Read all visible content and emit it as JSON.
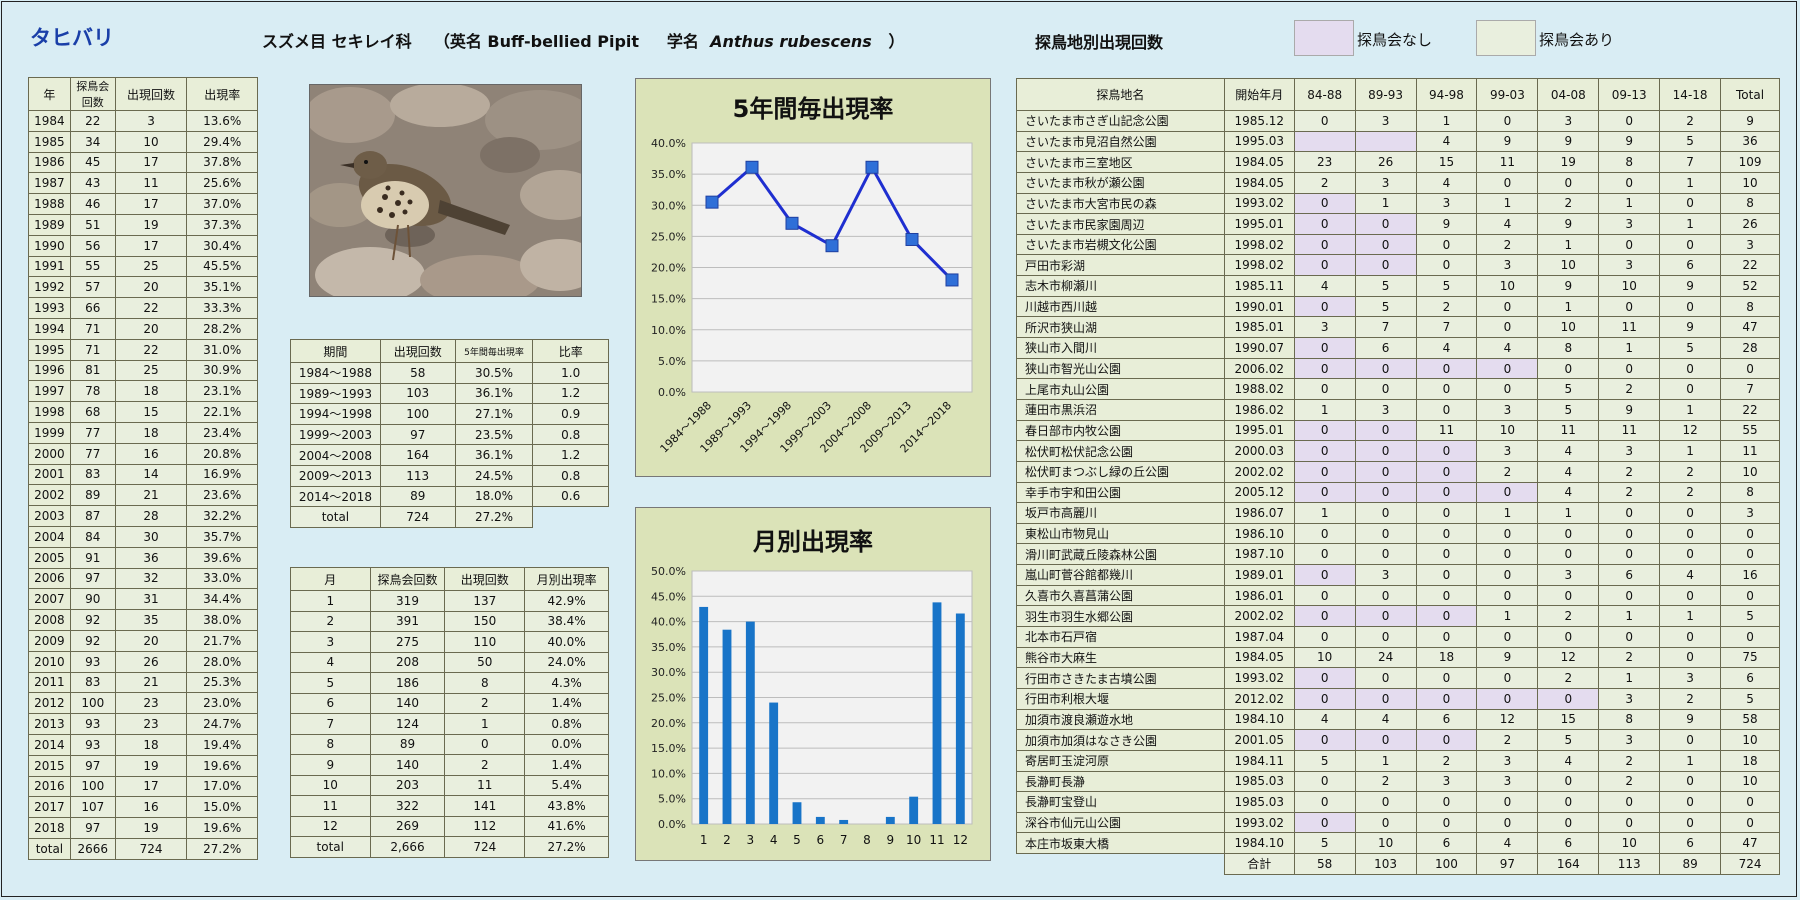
{
  "header": {
    "title": "タヒバリ",
    "order_family": "スズメ目 セキレイ科",
    "english_label": "（英名 Buff-bellied Pipit",
    "sci_label": "学名",
    "sci_name": "Anthus rubescens",
    "close_paren": "）",
    "site_table_heading": "探鳥地別出現回数",
    "legend_no_meeting": "探鳥会なし",
    "legend_meeting": "探鳥会あり",
    "colors": {
      "no_meeting": "#e4dcef",
      "meeting": "#e9efde",
      "title": "#1a3fa8",
      "series": "#1f2fd0",
      "bar": "#1874c8"
    }
  },
  "year_table": {
    "headers": [
      "年",
      "探鳥会回数",
      "出現回数",
      "出現率"
    ],
    "rows": [
      [
        "1984",
        "22",
        "3",
        "13.6%"
      ],
      [
        "1985",
        "34",
        "10",
        "29.4%"
      ],
      [
        "1986",
        "45",
        "17",
        "37.8%"
      ],
      [
        "1987",
        "43",
        "11",
        "25.6%"
      ],
      [
        "1988",
        "46",
        "17",
        "37.0%"
      ],
      [
        "1989",
        "51",
        "19",
        "37.3%"
      ],
      [
        "1990",
        "56",
        "17",
        "30.4%"
      ],
      [
        "1991",
        "55",
        "25",
        "45.5%"
      ],
      [
        "1992",
        "57",
        "20",
        "35.1%"
      ],
      [
        "1993",
        "66",
        "22",
        "33.3%"
      ],
      [
        "1994",
        "71",
        "20",
        "28.2%"
      ],
      [
        "1995",
        "71",
        "22",
        "31.0%"
      ],
      [
        "1996",
        "81",
        "25",
        "30.9%"
      ],
      [
        "1997",
        "78",
        "18",
        "23.1%"
      ],
      [
        "1998",
        "68",
        "15",
        "22.1%"
      ],
      [
        "1999",
        "77",
        "18",
        "23.4%"
      ],
      [
        "2000",
        "77",
        "16",
        "20.8%"
      ],
      [
        "2001",
        "83",
        "14",
        "16.9%"
      ],
      [
        "2002",
        "89",
        "21",
        "23.6%"
      ],
      [
        "2003",
        "87",
        "28",
        "32.2%"
      ],
      [
        "2004",
        "84",
        "30",
        "35.7%"
      ],
      [
        "2005",
        "91",
        "36",
        "39.6%"
      ],
      [
        "2006",
        "97",
        "32",
        "33.0%"
      ],
      [
        "2007",
        "90",
        "31",
        "34.4%"
      ],
      [
        "2008",
        "92",
        "35",
        "38.0%"
      ],
      [
        "2009",
        "92",
        "20",
        "21.7%"
      ],
      [
        "2010",
        "93",
        "26",
        "28.0%"
      ],
      [
        "2011",
        "83",
        "21",
        "25.3%"
      ],
      [
        "2012",
        "100",
        "23",
        "23.0%"
      ],
      [
        "2013",
        "93",
        "23",
        "24.7%"
      ],
      [
        "2014",
        "93",
        "18",
        "19.4%"
      ],
      [
        "2015",
        "97",
        "19",
        "19.6%"
      ],
      [
        "2016",
        "100",
        "17",
        "17.0%"
      ],
      [
        "2017",
        "107",
        "16",
        "15.0%"
      ],
      [
        "2018",
        "97",
        "19",
        "19.6%"
      ],
      [
        "total",
        "2666",
        "724",
        "27.2%"
      ]
    ]
  },
  "period_table": {
    "headers": [
      "期間",
      "出現回数",
      "5年間毎出現率",
      "比率"
    ],
    "rows": [
      [
        "1984～1988",
        "58",
        "30.5%",
        "1.0"
      ],
      [
        "1989～1993",
        "103",
        "36.1%",
        "1.2"
      ],
      [
        "1994～1998",
        "100",
        "27.1%",
        "0.9"
      ],
      [
        "1999～2003",
        "97",
        "23.5%",
        "0.8"
      ],
      [
        "2004～2008",
        "164",
        "36.1%",
        "1.2"
      ],
      [
        "2009～2013",
        "113",
        "24.5%",
        "0.8"
      ],
      [
        "2014～2018",
        "89",
        "18.0%",
        "0.6"
      ]
    ],
    "total_row": [
      "total",
      "724",
      "27.2%"
    ]
  },
  "month_table": {
    "headers": [
      "月",
      "探鳥会回数",
      "出現回数",
      "月別出現率"
    ],
    "rows": [
      [
        "1",
        "319",
        "137",
        "42.9%"
      ],
      [
        "2",
        "391",
        "150",
        "38.4%"
      ],
      [
        "3",
        "275",
        "110",
        "40.0%"
      ],
      [
        "4",
        "208",
        "50",
        "24.0%"
      ],
      [
        "5",
        "186",
        "8",
        "4.3%"
      ],
      [
        "6",
        "140",
        "2",
        "1.4%"
      ],
      [
        "7",
        "124",
        "1",
        "0.8%"
      ],
      [
        "8",
        "89",
        "0",
        "0.0%"
      ],
      [
        "9",
        "140",
        "2",
        "1.4%"
      ],
      [
        "10",
        "203",
        "11",
        "5.4%"
      ],
      [
        "11",
        "322",
        "141",
        "43.8%"
      ],
      [
        "12",
        "269",
        "112",
        "41.6%"
      ],
      [
        "total",
        "2,666",
        "724",
        "27.2%"
      ]
    ]
  },
  "site_table": {
    "headers": [
      "探鳥地名",
      "開始年月",
      "84-88",
      "89-93",
      "94-98",
      "99-03",
      "04-08",
      "09-13",
      "14-18",
      "Total"
    ],
    "rows": [
      [
        "さいたま市さぎ山記念公園",
        "1985.12",
        "0",
        "3",
        "1",
        "0",
        "3",
        "0",
        "2",
        "9"
      ],
      [
        "さいたま市見沼自然公園",
        "1995.03",
        "",
        "",
        "4",
        "9",
        "9",
        "9",
        "5",
        "36"
      ],
      [
        "さいたま市三室地区",
        "1984.05",
        "23",
        "26",
        "15",
        "11",
        "19",
        "8",
        "7",
        "109"
      ],
      [
        "さいたま市秋が瀬公園",
        "1984.05",
        "2",
        "3",
        "4",
        "0",
        "0",
        "0",
        "1",
        "10"
      ],
      [
        "さいたま市大宮市民の森",
        "1993.02",
        "0",
        "1",
        "3",
        "1",
        "2",
        "1",
        "0",
        "8"
      ],
      [
        "さいたま市民家園周辺",
        "1995.01",
        "0",
        "0",
        "9",
        "4",
        "9",
        "3",
        "1",
        "26"
      ],
      [
        "さいたま市岩槻文化公園",
        "1998.02",
        "0",
        "0",
        "0",
        "2",
        "1",
        "0",
        "0",
        "3"
      ],
      [
        "戸田市彩湖",
        "1998.02",
        "0",
        "0",
        "0",
        "3",
        "10",
        "3",
        "6",
        "22"
      ],
      [
        "志木市柳瀬川",
        "1985.11",
        "4",
        "5",
        "5",
        "10",
        "9",
        "10",
        "9",
        "52"
      ],
      [
        "川越市西川越",
        "1990.01",
        "0",
        "5",
        "2",
        "0",
        "1",
        "0",
        "0",
        "8"
      ],
      [
        "所沢市狭山湖",
        "1985.01",
        "3",
        "7",
        "7",
        "0",
        "10",
        "11",
        "9",
        "47"
      ],
      [
        "狭山市入間川",
        "1990.07",
        "0",
        "6",
        "4",
        "4",
        "8",
        "1",
        "5",
        "28"
      ],
      [
        "狭山市智光山公園",
        "2006.02",
        "0",
        "0",
        "0",
        "0",
        "0",
        "0",
        "0",
        "0"
      ],
      [
        "上尾市丸山公園",
        "1988.02",
        "0",
        "0",
        "0",
        "0",
        "5",
        "2",
        "0",
        "7"
      ],
      [
        "蓮田市黒浜沼",
        "1986.02",
        "1",
        "3",
        "0",
        "3",
        "5",
        "9",
        "1",
        "22"
      ],
      [
        "春日部市内牧公園",
        "1995.01",
        "0",
        "0",
        "11",
        "10",
        "11",
        "11",
        "12",
        "55"
      ],
      [
        "松伏町松伏記念公園",
        "2000.03",
        "0",
        "0",
        "0",
        "3",
        "4",
        "3",
        "1",
        "11"
      ],
      [
        "松伏町まつぶし緑の丘公園",
        "2002.02",
        "0",
        "0",
        "0",
        "2",
        "4",
        "2",
        "2",
        "10"
      ],
      [
        "幸手市宇和田公園",
        "2005.12",
        "0",
        "0",
        "0",
        "0",
        "4",
        "2",
        "2",
        "8"
      ],
      [
        "坂戸市高麗川",
        "1986.07",
        "1",
        "0",
        "0",
        "1",
        "1",
        "0",
        "0",
        "3"
      ],
      [
        "東松山市物見山",
        "1986.10",
        "0",
        "0",
        "0",
        "0",
        "0",
        "0",
        "0",
        "0"
      ],
      [
        "滑川町武蔵丘陵森林公園",
        "1987.10",
        "0",
        "0",
        "0",
        "0",
        "0",
        "0",
        "0",
        "0"
      ],
      [
        "嵐山町菅谷館都幾川",
        "1989.01",
        "0",
        "3",
        "0",
        "0",
        "3",
        "6",
        "4",
        "16"
      ],
      [
        "久喜市久喜菖蒲公園",
        "1986.01",
        "0",
        "0",
        "0",
        "0",
        "0",
        "0",
        "0",
        "0"
      ],
      [
        "羽生市羽生水郷公園",
        "2002.02",
        "0",
        "0",
        "0",
        "1",
        "2",
        "1",
        "1",
        "5"
      ],
      [
        "北本市石戸宿",
        "1987.04",
        "0",
        "0",
        "0",
        "0",
        "0",
        "0",
        "0",
        "0"
      ],
      [
        "熊谷市大麻生",
        "1984.05",
        "10",
        "24",
        "18",
        "9",
        "12",
        "2",
        "0",
        "75"
      ],
      [
        "行田市さきたま古墳公園",
        "1993.02",
        "0",
        "0",
        "0",
        "0",
        "2",
        "1",
        "3",
        "6"
      ],
      [
        "行田市利根大堰",
        "2012.02",
        "0",
        "0",
        "0",
        "0",
        "0",
        "3",
        "2",
        "5"
      ],
      [
        "加須市渡良瀬遊水地",
        "1984.10",
        "4",
        "4",
        "6",
        "12",
        "15",
        "8",
        "9",
        "58"
      ],
      [
        "加須市加須はなさき公園",
        "2001.05",
        "0",
        "0",
        "0",
        "2",
        "5",
        "3",
        "0",
        "10"
      ],
      [
        "寄居町玉淀河原",
        "1984.11",
        "5",
        "1",
        "2",
        "3",
        "4",
        "2",
        "1",
        "18"
      ],
      [
        "長瀞町長瀞",
        "1985.03",
        "0",
        "2",
        "3",
        "3",
        "0",
        "2",
        "0",
        "10"
      ],
      [
        "長瀞町宝登山",
        "1985.03",
        "0",
        "0",
        "0",
        "0",
        "0",
        "0",
        "0",
        "0"
      ],
      [
        "深谷市仙元山公園",
        "1993.02",
        "0",
        "0",
        "0",
        "0",
        "0",
        "0",
        "0",
        "0"
      ],
      [
        "本庄市坂東大橋",
        "1984.10",
        "5",
        "10",
        "6",
        "4",
        "6",
        "10",
        "6",
        "47"
      ]
    ],
    "total_row": [
      "合計",
      "58",
      "103",
      "100",
      "97",
      "164",
      "113",
      "89",
      "724"
    ]
  },
  "chart_data": [
    {
      "type": "line",
      "title": "5年間毎出現率",
      "categories": [
        "1984～1988",
        "1989～1993",
        "1994～1998",
        "1999～2003",
        "2004～2008",
        "2009～2013",
        "2014～2018"
      ],
      "values": [
        30.5,
        36.1,
        27.1,
        23.5,
        36.1,
        24.5,
        18.0
      ],
      "ylim": [
        0,
        40
      ],
      "yticks": [
        "0.0%",
        "5.0%",
        "10.0%",
        "15.0%",
        "20.0%",
        "25.0%",
        "30.0%",
        "35.0%",
        "40.0%"
      ],
      "grid": true,
      "legend": "none"
    },
    {
      "type": "bar",
      "title": "月別出現率",
      "categories": [
        "1",
        "2",
        "3",
        "4",
        "5",
        "6",
        "7",
        "8",
        "9",
        "10",
        "11",
        "12"
      ],
      "values": [
        42.9,
        38.4,
        40.0,
        24.0,
        4.3,
        1.4,
        0.8,
        0.0,
        1.4,
        5.4,
        43.8,
        41.6
      ],
      "ylim": [
        0,
        50
      ],
      "yticks": [
        "0.0%",
        "5.0%",
        "10.0%",
        "15.0%",
        "20.0%",
        "25.0%",
        "30.0%",
        "35.0%",
        "40.0%",
        "45.0%",
        "50.0%"
      ],
      "grid": true,
      "legend": "none"
    }
  ]
}
